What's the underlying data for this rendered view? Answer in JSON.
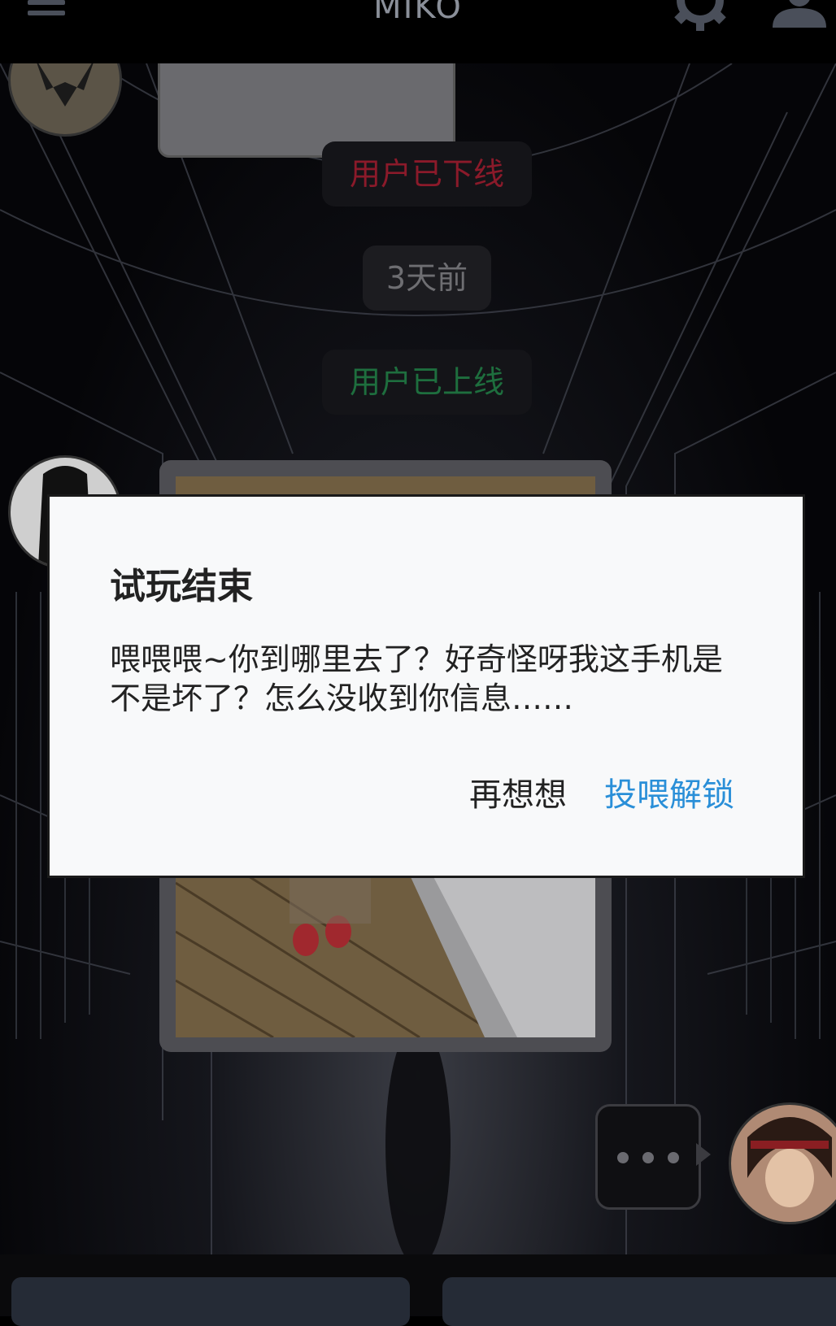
{
  "header": {
    "title": "MIKO",
    "menu_icon": "menu-icon",
    "settings_icon": "gear-icon",
    "profile_icon": "person-icon"
  },
  "chat": {
    "system_messages": [
      {
        "text": "用户已下线",
        "color": "#8b1a2a"
      },
      {
        "text": "3天前",
        "color": "#6e6e72"
      },
      {
        "text": "用户已上线",
        "color": "#1e6e3e"
      }
    ]
  },
  "dialog": {
    "title": "试玩结束",
    "message": "喂喂喂~你到哪里去了？好奇怪呀我这手机是不是坏了？怎么没收到你信息……",
    "cancel_label": "再想想",
    "confirm_label": "投喂解锁",
    "accent_color": "#2a8fd8"
  }
}
